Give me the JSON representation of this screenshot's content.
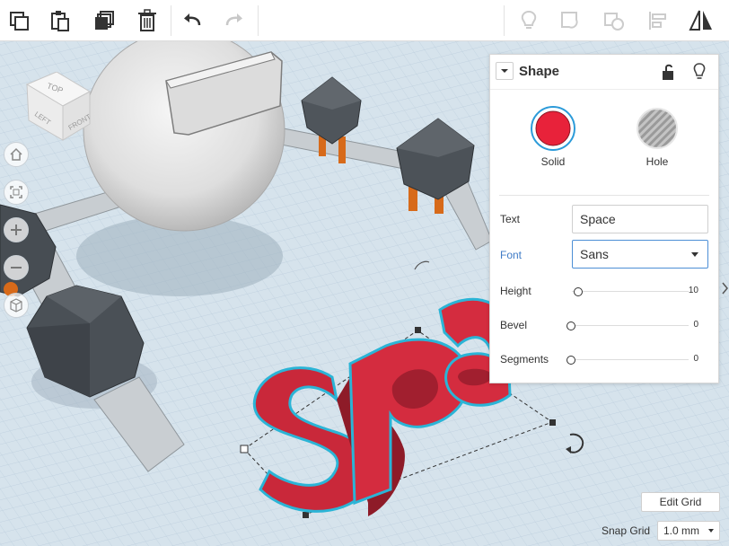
{
  "toolbar": {
    "buttons": [
      {
        "icon": "copy-icon"
      },
      {
        "icon": "paste-icon"
      },
      {
        "icon": "duplicate-icon"
      },
      {
        "icon": "delete-icon"
      },
      {
        "icon": "undo-icon"
      },
      {
        "icon": "redo-icon"
      },
      {
        "icon": "lightbulb-icon"
      },
      {
        "icon": "group-icon"
      },
      {
        "icon": "ungroup-icon"
      },
      {
        "icon": "align-icon"
      },
      {
        "icon": "mirror-icon"
      }
    ]
  },
  "view_cube": {
    "top": "TOP",
    "left": "LEFT",
    "front": "FRONT"
  },
  "scene": {
    "text_object": "Space",
    "colors": {
      "text_red": "#e2323e",
      "outline": "#2bb4d6",
      "grid": "#cfdde8",
      "gray_object": "#4a4f55"
    }
  },
  "panel": {
    "title": "Shape",
    "solid_label": "Solid",
    "hole_label": "Hole",
    "solid_color": "#e8223a",
    "text_label": "Text",
    "text_value": "Space",
    "font_label": "Font",
    "font_value": "Sans",
    "height_label": "Height",
    "height_value": "10",
    "height_level": 0.05,
    "bevel_label": "Bevel",
    "bevel_value": "0",
    "segments_label": "Segments",
    "segments_value": "0"
  },
  "bottom": {
    "edit_grid": "Edit Grid",
    "snap_grid_label": "Snap Grid",
    "snap_grid_value": "1.0 mm"
  }
}
